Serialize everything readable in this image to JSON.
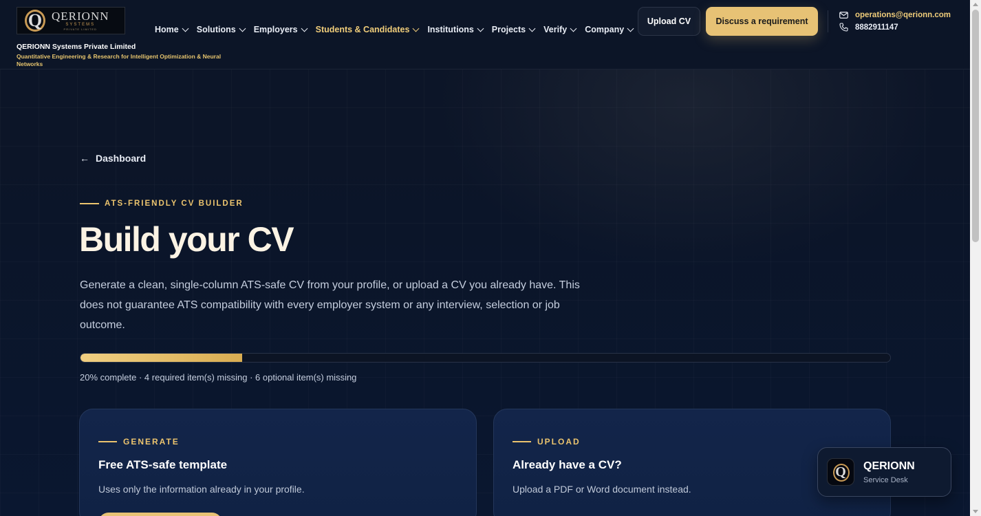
{
  "brand": {
    "logo_word": "QERIONN",
    "logo_sub": "SYSTEMS",
    "logo_sub2": "PRIVATE LIMITED",
    "company_name": "QERIONN Systems Private Limited",
    "tagline": "Quantitative Engineering & Research for Intelligent Optimization & Neural Networks"
  },
  "nav": {
    "items": [
      {
        "label": "Home"
      },
      {
        "label": "Solutions"
      },
      {
        "label": "Employers"
      },
      {
        "label": "Students & Candidates",
        "active": true
      },
      {
        "label": "Institutions"
      },
      {
        "label": "Projects"
      },
      {
        "label": "Verify"
      },
      {
        "label": "Company"
      }
    ]
  },
  "header": {
    "upload_cv_label": "Upload CV",
    "discuss_label": "Discuss a requirement",
    "email": "operations@qerionn.com",
    "phone": "8882911147"
  },
  "main": {
    "back_label": "Dashboard",
    "eyebrow": "ATS-FRIENDLY CV BUILDER",
    "title": "Build your CV",
    "lead": "Generate a clean, single-column ATS-safe CV from your profile, or upload a CV you already have. This does not guarantee ATS compatibility with every employer system or any interview, selection or job outcome.",
    "progress_percent": 20,
    "progress_text": "20% complete · 4 required item(s) missing · 6 optional item(s) missing"
  },
  "cards": {
    "generate": {
      "eyebrow": "GENERATE",
      "title": "Free ATS-safe template",
      "description": "Uses only the information already in your profile."
    },
    "upload": {
      "eyebrow": "UPLOAD",
      "title": "Already have a CV?",
      "description": "Upload a PDF or Word document instead."
    }
  },
  "service_desk": {
    "title": "QERIONN",
    "subtitle": "Service Desk"
  },
  "colors": {
    "accent_gold": "#e7c275",
    "background": "#0b1426",
    "card": "#13254a"
  }
}
